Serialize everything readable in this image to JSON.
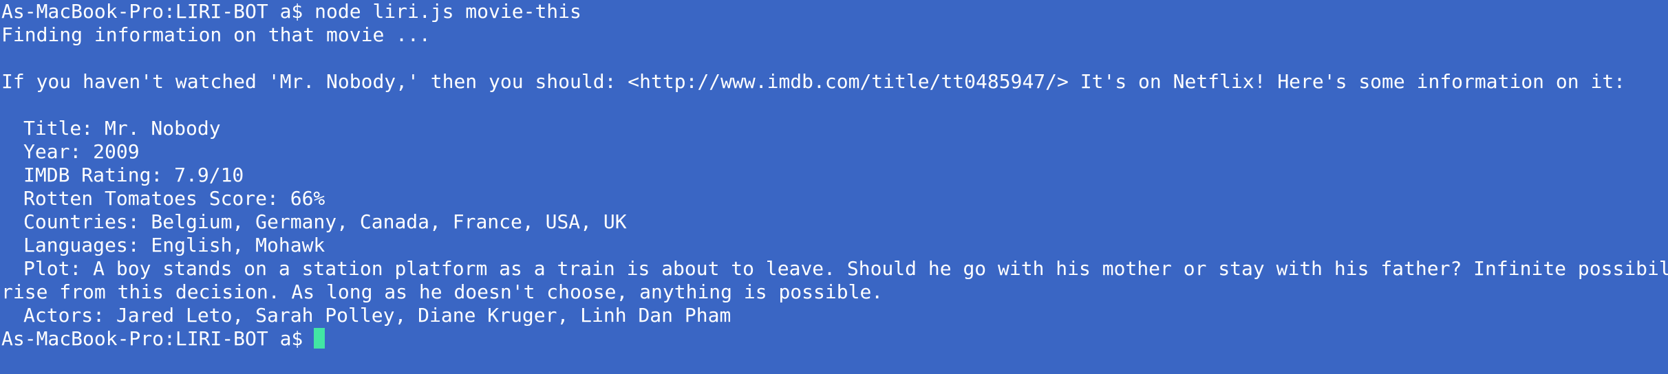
{
  "terminal": {
    "lines": {
      "cmd": "As-MacBook-Pro:LIRI-BOT a$ node liri.js movie-this",
      "finding": "Finding information on that movie ...",
      "intro": "If you haven't watched 'Mr. Nobody,' then you should: <http://www.imdb.com/title/tt0485947/> It's on Netflix! Here's some information on it:",
      "title": "Title: Mr. Nobody",
      "year": "Year: 2009",
      "imdb": "IMDB Rating: 7.9/10",
      "rotten": "Rotten Tomatoes Score: 66%",
      "countries": "Countries: Belgium, Germany, Canada, France, USA, UK",
      "languages": "Languages: English, Mohawk",
      "plot_1": "Plot: A boy stands on a station platform as a train is about to leave. Should he go with his mother or stay with his father? Infinite possibilities a",
      "plot_2": "rise from this decision. As long as he doesn't choose, anything is possible.",
      "actors": "Actors: Jared Leto, Sarah Polley, Diane Kruger, Linh Dan Pham",
      "prompt": "As-MacBook-Pro:LIRI-BOT a$"
    },
    "colors": {
      "background": "#3a66c4",
      "text": "#ffffff",
      "cursor": "#42e6a4"
    }
  }
}
